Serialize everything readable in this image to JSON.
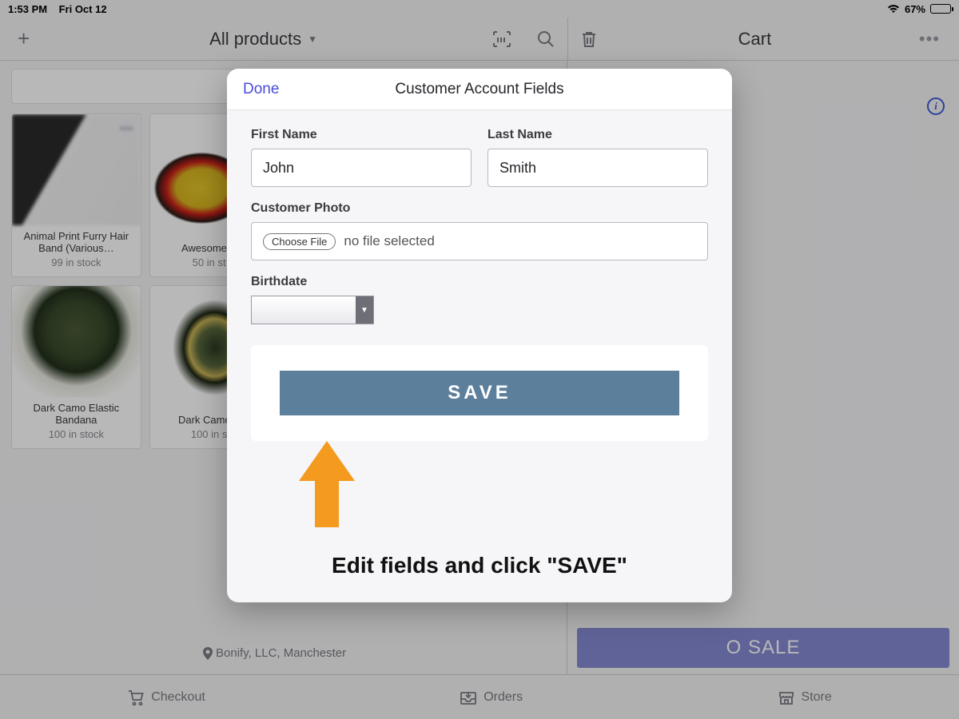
{
  "statusbar": {
    "time": "1:53 PM",
    "date": "Fri Oct 12",
    "battery_pct": "67%"
  },
  "toolbar": {
    "all_products": "All products",
    "cart_title": "Cart"
  },
  "products": [
    {
      "name": "Animal Print Furry Hair Band (Various…",
      "stock": "99 in stock"
    },
    {
      "name": "Awesome S…",
      "stock": "50 in st…"
    },
    {
      "name": "Dark Camo Elastic Bandana",
      "stock": "100 in stock"
    },
    {
      "name": "Dark Camo Z…",
      "stock": "100 in s…"
    }
  ],
  "cart": {
    "location": "Bonify, LLC, Manchester",
    "add_sale": "O SALE"
  },
  "modal": {
    "done": "Done",
    "title": "Customer Account Fields",
    "first_name_label": "First Name",
    "first_name_value": "John",
    "last_name_label": "Last Name",
    "last_name_value": "Smith",
    "photo_label": "Customer Photo",
    "choose_file": "Choose File",
    "file_status": "no file selected",
    "birthdate_label": "Birthdate",
    "save": "SAVE",
    "caption": "Edit fields and click \"SAVE\""
  },
  "bottomnav": {
    "checkout": "Checkout",
    "orders": "Orders",
    "store": "Store"
  }
}
